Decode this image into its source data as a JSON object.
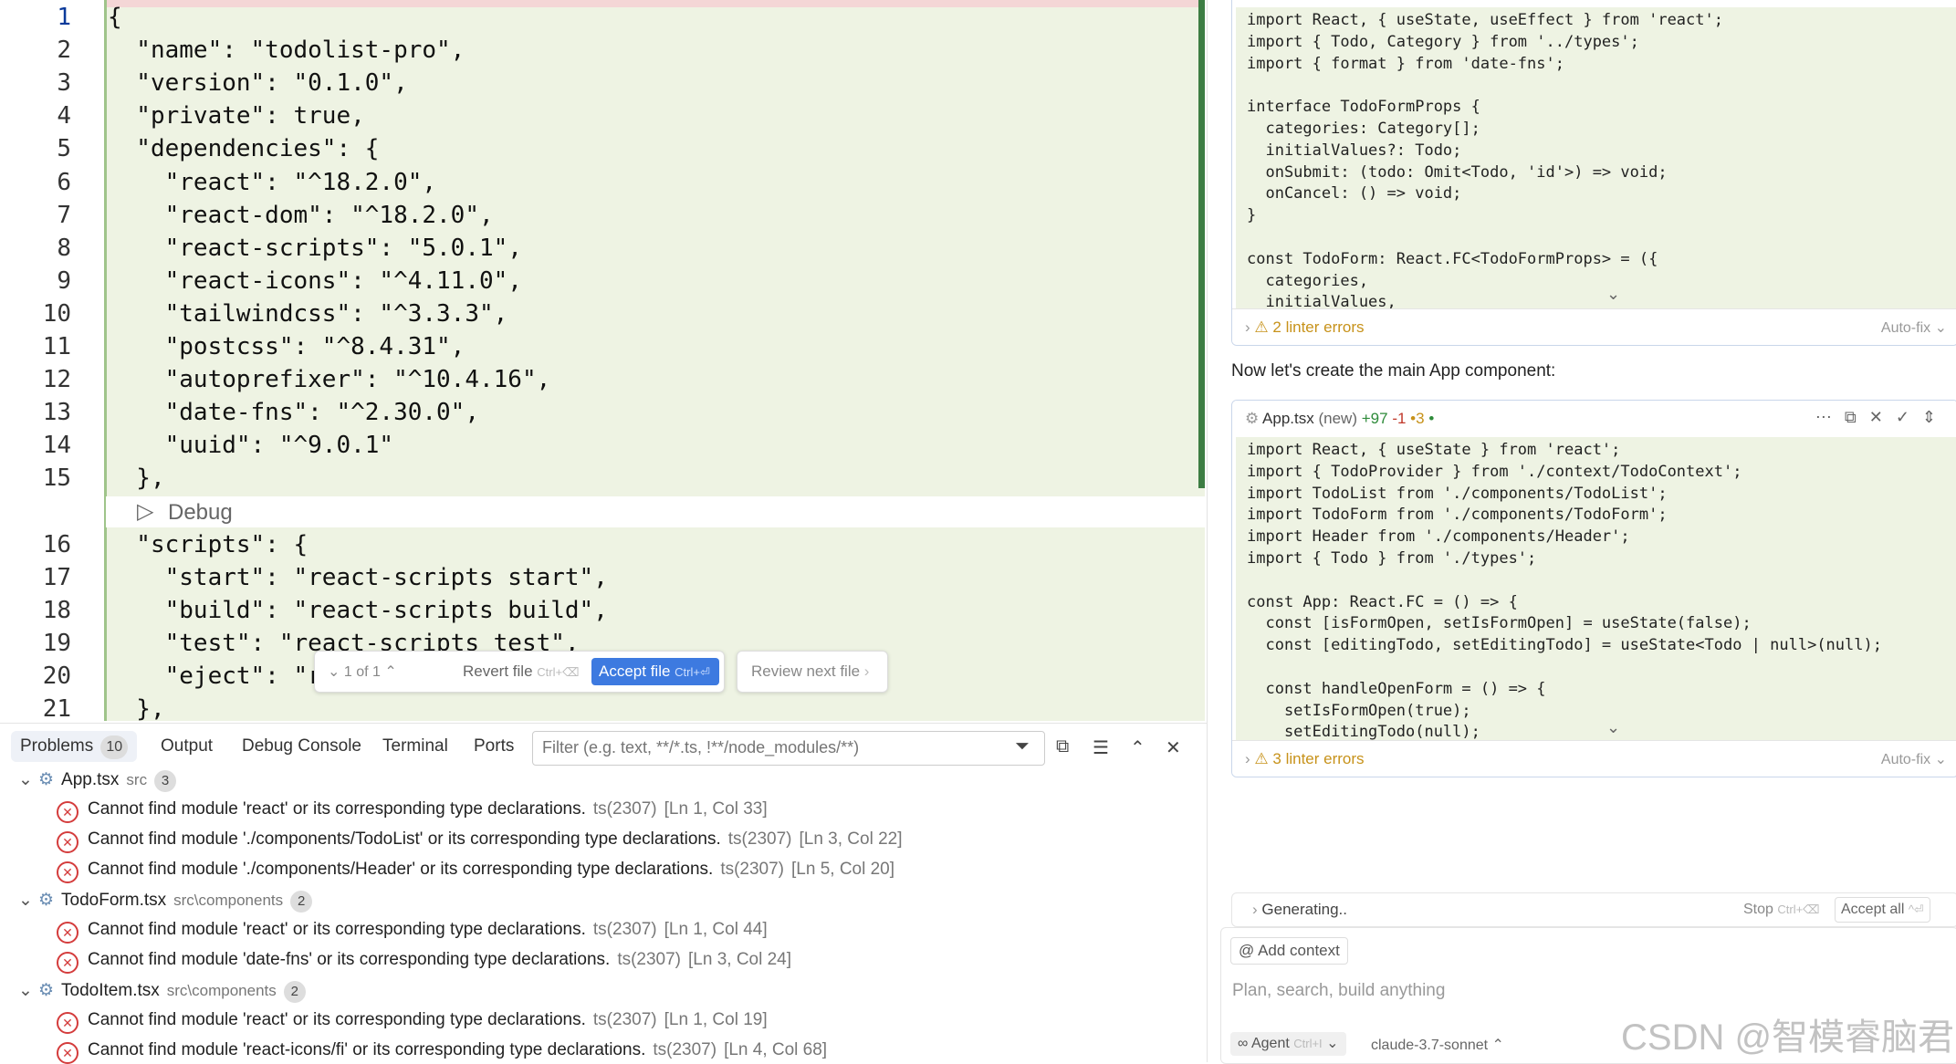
{
  "editor": {
    "line_numbers": [
      "1",
      "2",
      "3",
      "4",
      "5",
      "6",
      "7",
      "8",
      "9",
      "10",
      "11",
      "12",
      "13",
      "14",
      "15",
      "16",
      "17",
      "18",
      "19",
      "20",
      "21"
    ],
    "lines": [
      "{",
      "  \"name\": \"todolist-pro\",",
      "  \"version\": \"0.1.0\",",
      "  \"private\": true,",
      "  \"dependencies\": {",
      "    \"react\": \"^18.2.0\",",
      "    \"react-dom\": \"^18.2.0\",",
      "    \"react-scripts\": \"5.0.1\",",
      "    \"react-icons\": \"^4.11.0\",",
      "    \"tailwindcss\": \"^3.3.3\",",
      "    \"postcss\": \"^8.4.31\",",
      "    \"autoprefixer\": \"^10.4.16\",",
      "    \"date-fns\": \"^2.30.0\",",
      "    \"uuid\": \"^9.0.1\"",
      "  },",
      "  \"scripts\": {",
      "    \"start\": \"react-scripts start\",",
      "    \"build\": \"react-scripts build\",",
      "    \"test\": \"react-scripts test\",",
      "    \"eject\": \"re",
      "  },"
    ],
    "debug_label": "Debug"
  },
  "diff_bar": {
    "counter": "1 of 1",
    "revert_label": "Revert file",
    "revert_hint": "Ctrl+⌫",
    "accept_label": "Accept file",
    "accept_hint": "Ctrl+⏎",
    "review_label": "Review next file"
  },
  "panel": {
    "tabs": {
      "problems": "Problems",
      "problems_count": "10",
      "output": "Output",
      "debug_console": "Debug Console",
      "terminal": "Terminal",
      "ports": "Ports"
    },
    "filter_placeholder": "Filter (e.g. text, **/*.ts, !**/node_modules/**)",
    "groups": [
      {
        "file": "App.tsx",
        "path": "src",
        "count": "3",
        "errors": [
          {
            "msg": "Cannot find module 'react' or its corresponding type declarations.",
            "code": "ts(2307)",
            "loc": "[Ln 1, Col 33]"
          },
          {
            "msg": "Cannot find module './components/TodoList' or its corresponding type declarations.",
            "code": "ts(2307)",
            "loc": "[Ln 3, Col 22]"
          },
          {
            "msg": "Cannot find module './components/Header' or its corresponding type declarations.",
            "code": "ts(2307)",
            "loc": "[Ln 5, Col 20]"
          }
        ]
      },
      {
        "file": "TodoForm.tsx",
        "path": "src\\components",
        "count": "2",
        "errors": [
          {
            "msg": "Cannot find module 'react' or its corresponding type declarations.",
            "code": "ts(2307)",
            "loc": "[Ln 1, Col 44]"
          },
          {
            "msg": "Cannot find module 'date-fns' or its corresponding type declarations.",
            "code": "ts(2307)",
            "loc": "[Ln 3, Col 24]"
          }
        ]
      },
      {
        "file": "TodoItem.tsx",
        "path": "src\\components",
        "count": "2",
        "errors": [
          {
            "msg": "Cannot find module 'react' or its corresponding type declarations.",
            "code": "ts(2307)",
            "loc": "[Ln 1, Col 19]"
          },
          {
            "msg": "Cannot find module 'react-icons/fi' or its corresponding type declarations.",
            "code": "ts(2307)",
            "loc": "[Ln 4, Col 68]"
          }
        ]
      }
    ]
  },
  "chat": {
    "card1": {
      "lines": [
        "import React, { useState, useEffect } from 'react';",
        "import { Todo, Category } from '../types';",
        "import { format } from 'date-fns';",
        "",
        "interface TodoFormProps {",
        "  categories: Category[];",
        "  initialValues?: Todo;",
        "  onSubmit: (todo: Omit<Todo, 'id'>) => void;",
        "  onCancel: () => void;",
        "}",
        "",
        "const TodoForm: React.FC<TodoFormProps> = ({",
        "  categories,",
        "  initialValues,"
      ],
      "lint": "2 linter errors",
      "autofix": "Auto-fix"
    },
    "message": "Now let's create the main App component:",
    "card2": {
      "file": "App.tsx",
      "tag": "(new)",
      "added": "+97",
      "removed": "-1",
      "warn": "•3",
      "lines": [
        "import React, { useState } from 'react';",
        "import { TodoProvider } from './context/TodoContext';",
        "import TodoList from './components/TodoList';",
        "import TodoForm from './components/TodoForm';",
        "import Header from './components/Header';",
        "import { Todo } from './types';",
        "",
        "const App: React.FC = () => {",
        "  const [isFormOpen, setIsFormOpen] = useState(false);",
        "  const [editingTodo, setEditingTodo] = useState<Todo | null>(null);",
        "",
        "  const handleOpenForm = () => {",
        "    setIsFormOpen(true);",
        "    setEditingTodo(null);"
      ],
      "lint": "3 linter errors",
      "autofix": "Auto-fix"
    },
    "generating": "Generating..",
    "stop_label": "Stop",
    "stop_hint": "Ctrl+⌫",
    "accept_all": "Accept all",
    "accept_all_hint": "^⏎",
    "add_context": "Add context",
    "prompt_placeholder": "Plan, search, build anything",
    "agent_label": "Agent",
    "agent_hint": "Ctrl+I",
    "model": "claude-3.7-sonnet"
  },
  "watermark": "CSDN @智模睿脑君",
  "icons": [
    "chevron-down-icon",
    "chevron-right-icon",
    "file-icon",
    "error-icon",
    "filter-icon",
    "collapse-icon",
    "list-icon",
    "chevron-up-icon",
    "close-icon",
    "warning-icon",
    "copy-icon",
    "check-icon",
    "at-icon",
    "infinity-icon"
  ]
}
